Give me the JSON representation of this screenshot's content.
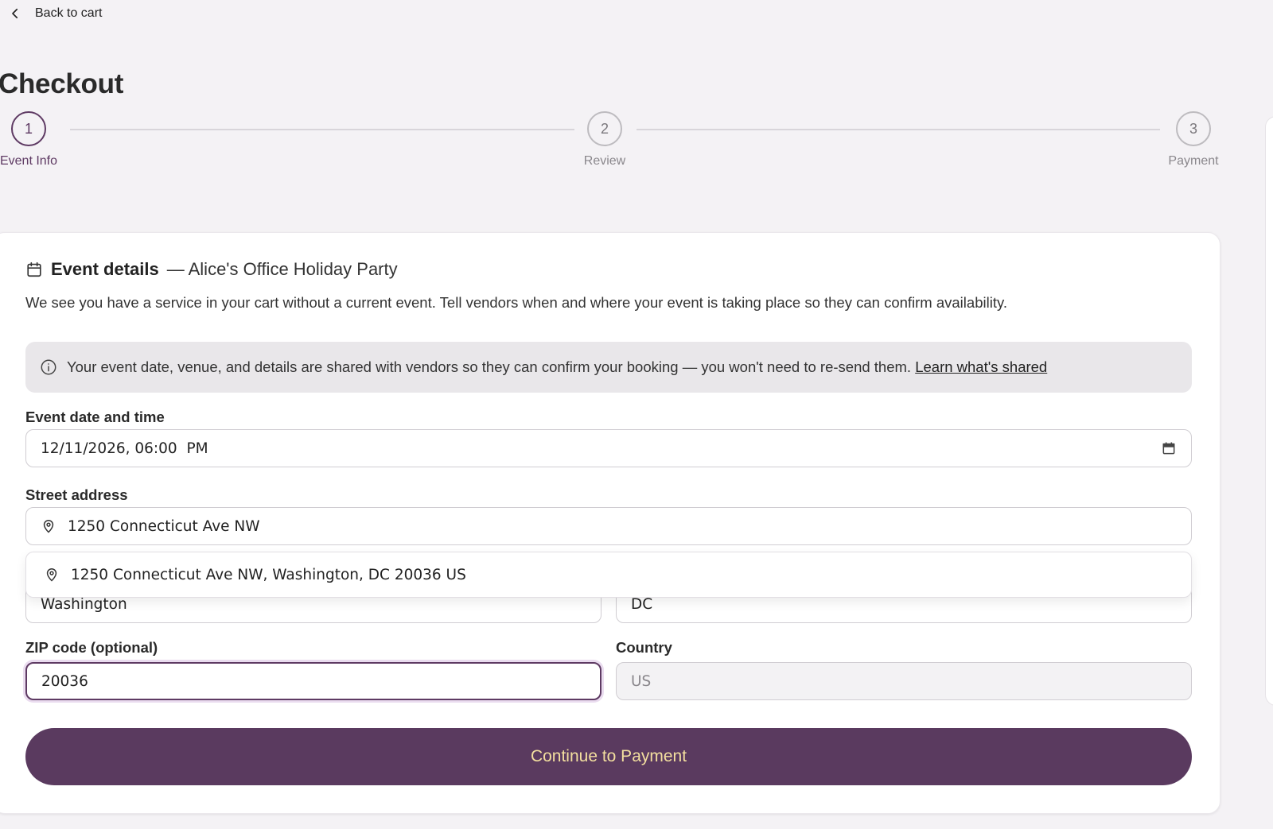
{
  "nav": {
    "back_label": "Back to cart"
  },
  "page": {
    "title": "Checkout"
  },
  "stepper": {
    "steps": [
      {
        "number": "1",
        "label": "Event Info"
      },
      {
        "number": "2",
        "label": "Review"
      },
      {
        "number": "3",
        "label": "Payment"
      }
    ],
    "active_step": 1
  },
  "event": {
    "heading": "Event details",
    "event_name": "— Alice's Office Holiday Party",
    "description": "We see you have a service in your cart without a current event. Tell vendors when and where your event is taking place so they can confirm availability.",
    "info_text": "Your event date, venue, and details are shared with vendors so they can confirm your booking — you won't need to re-send them.",
    "info_link": "Learn what's shared"
  },
  "form": {
    "datetime_label": "Event date and time",
    "datetime_value": "12/11/2026, 06:00  PM",
    "street_label": "Street address",
    "street_value": "1250 Connecticut Ave NW",
    "suggestion": "1250 Connecticut Ave NW, Washington, DC 20036 US",
    "city_value": "Washington",
    "state_value": "DC",
    "zip_label": "ZIP code (optional)",
    "zip_value": "20036",
    "country_label": "Country",
    "country_value": "US"
  },
  "actions": {
    "continue_label": "Continue to Payment"
  },
  "colors": {
    "accent": "#5a3a5f",
    "cta_text": "#f3df9f",
    "background": "#f4f2f5"
  },
  "icons": {
    "back": "chevron-left-icon",
    "calendar": "calendar-icon",
    "info": "info-icon",
    "location": "map-pin-icon"
  }
}
